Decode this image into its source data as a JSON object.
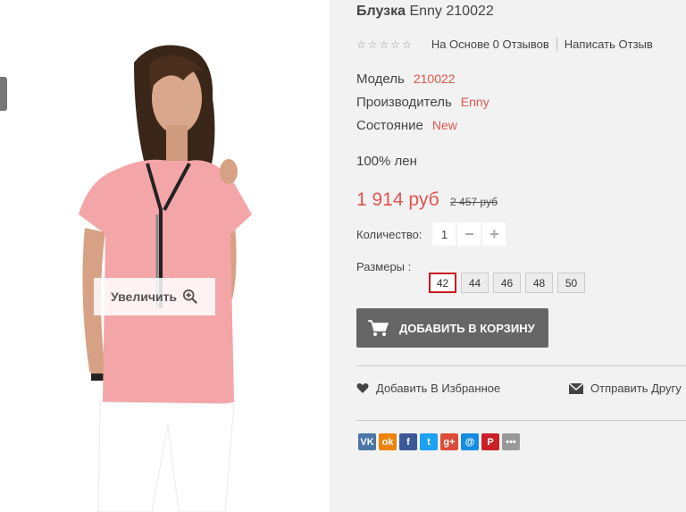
{
  "product": {
    "name": "Блузка",
    "brand_model": "Enny 210022",
    "rating_text": "На Основе 0 Отзывов",
    "write_review": "Написать Отзыв",
    "model_label": "Модель",
    "model_value": "210022",
    "maker_label": "Производитель",
    "maker_value": "Enny",
    "state_label": "Состояние",
    "state_value": "New",
    "description": "100% лен",
    "price": "1 914 руб",
    "old_price": "2 457 руб",
    "qty_label": "Количество:",
    "qty_value": "1",
    "sizes_label": "Размеры :",
    "sizes": [
      "42",
      "44",
      "46",
      "48",
      "50"
    ],
    "selected_size": "42",
    "add_to_cart": "ДОБАВИТЬ В КОРЗИНУ",
    "wishlist": "Добавить В Избранное",
    "send_friend": "Отправить Другу",
    "zoom_label": "Увеличить"
  },
  "colors": {
    "accent": "#e0554f",
    "button": "#666666",
    "selected_border": "#c9191e"
  },
  "social": [
    {
      "name": "vk",
      "glyph": "VK",
      "color": "#4a76a8"
    },
    {
      "name": "odnoklassniki",
      "glyph": "ok",
      "color": "#ee8208"
    },
    {
      "name": "facebook",
      "glyph": "f",
      "color": "#3b5998"
    },
    {
      "name": "twitter",
      "glyph": "t",
      "color": "#1da1f2"
    },
    {
      "name": "google-plus",
      "glyph": "g+",
      "color": "#dd4b39"
    },
    {
      "name": "mail",
      "glyph": "@",
      "color": "#168de2"
    },
    {
      "name": "pinterest",
      "glyph": "P",
      "color": "#cb2027"
    },
    {
      "name": "more",
      "glyph": "•••",
      "color": "#999999"
    }
  ]
}
